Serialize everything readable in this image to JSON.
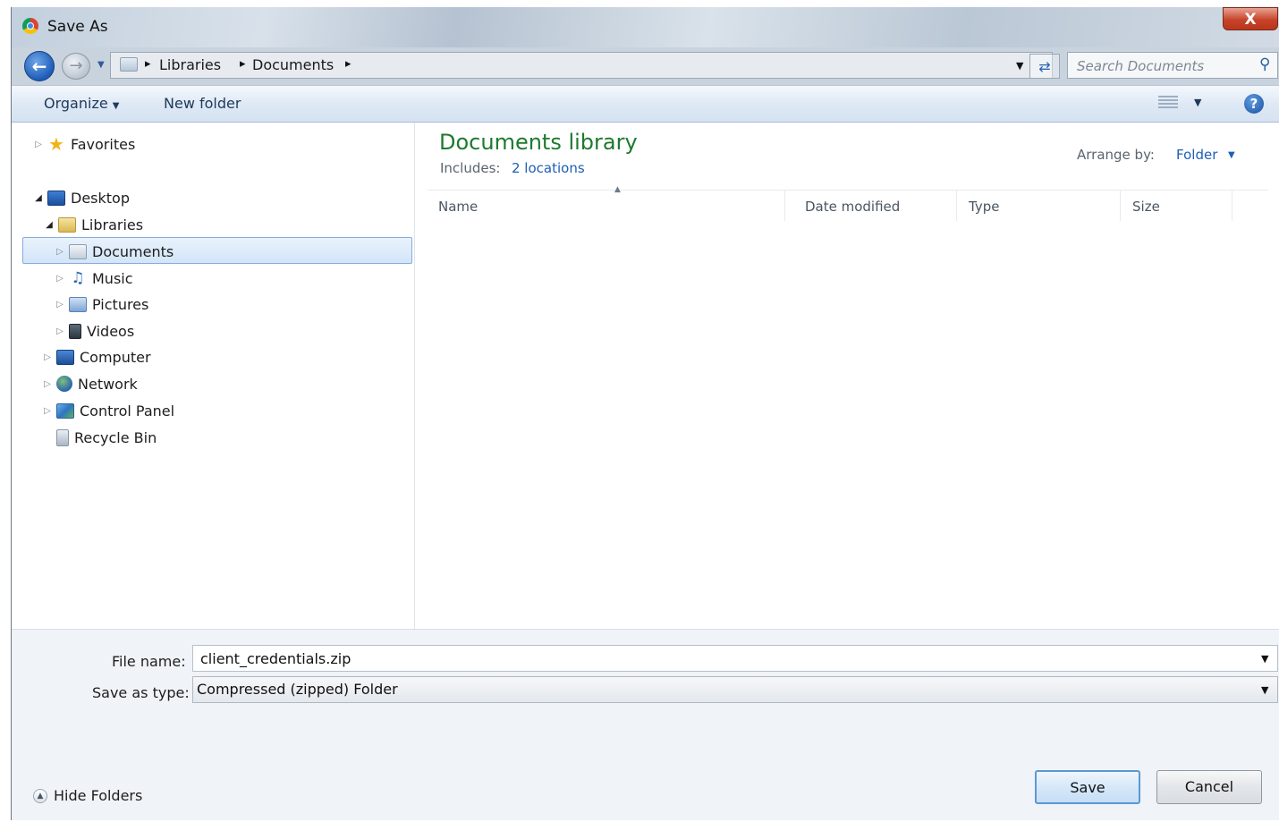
{
  "window": {
    "title": "Save As",
    "close_glyph": "X"
  },
  "address": {
    "crumbs": [
      "Libraries",
      "Documents"
    ],
    "search_placeholder": "Search Documents"
  },
  "toolbar": {
    "organize": "Organize",
    "new_folder": "New folder"
  },
  "nav_tree": {
    "favorites": "Favorites",
    "desktop": "Desktop",
    "libraries": "Libraries",
    "documents": "Documents",
    "music": "Music",
    "pictures": "Pictures",
    "videos": "Videos",
    "computer": "Computer",
    "network": "Network",
    "control_panel": "Control Panel",
    "recycle_bin": "Recycle Bin",
    "selected": "Documents"
  },
  "content": {
    "title": "Documents library",
    "includes_label": "Includes:",
    "includes_link": "2 locations",
    "arrange_label": "Arrange by:",
    "arrange_value": "Folder",
    "columns": [
      "Name",
      "Date modified",
      "Type",
      "Size"
    ]
  },
  "form": {
    "file_name_label": "File name:",
    "file_name_value": "client_credentials.zip",
    "save_type_label": "Save as type:",
    "save_type_value": "Compressed (zipped) Folder"
  },
  "footer": {
    "hide_folders": "Hide Folders",
    "save": "Save",
    "cancel": "Cancel"
  },
  "icons": {
    "app": "chrome-icon",
    "back": "back-arrow-icon",
    "forward": "forward-arrow-icon",
    "search": "search-icon",
    "refresh": "refresh-icon",
    "help": "help-icon",
    "views": "views-icon"
  },
  "colors": {
    "library_title": "#1e7a2e",
    "link": "#1e5fb4",
    "close": "#c7432a",
    "selection": "#d3e5f9"
  }
}
